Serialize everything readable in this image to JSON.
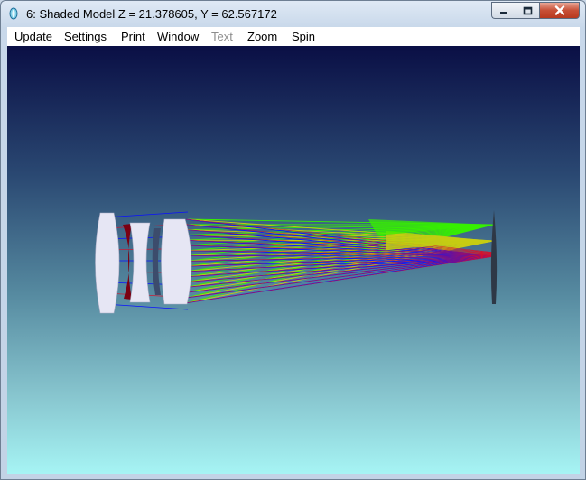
{
  "window": {
    "title": "6: Shaded Model Z = 21.378605, Y = 62.567172",
    "controls": {
      "minimize": "minimize",
      "maximize": "maximize",
      "close": "close"
    }
  },
  "menu": [
    {
      "label": "Update",
      "accel": "U",
      "enabled": true
    },
    {
      "label": "Settings",
      "accel": "S",
      "enabled": true
    },
    {
      "label": "Print",
      "accel": "P",
      "enabled": true
    },
    {
      "label": "Window",
      "accel": "W",
      "enabled": true
    },
    {
      "label": "Text",
      "accel": "T",
      "enabled": false
    },
    {
      "label": "Zoom",
      "accel": "Z",
      "enabled": true
    },
    {
      "label": "Spin",
      "accel": "S",
      "enabled": true
    }
  ],
  "colors": {
    "ray_blue": "#0a10ff",
    "ray_green": "#37f000",
    "ray_red": "#d8102a",
    "ray_yellow": "#c6cc12",
    "lens_face": "#e6e6f4",
    "lens_edge": "#8a0010"
  }
}
